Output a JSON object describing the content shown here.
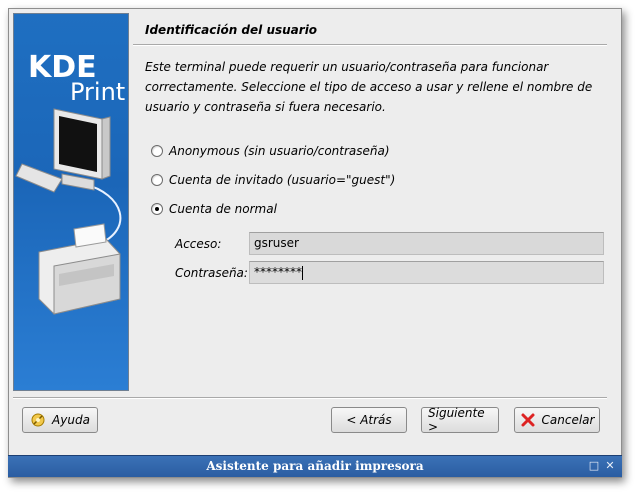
{
  "sidebar": {
    "logo_line1": "KDE",
    "logo_line2": "Print"
  },
  "page": {
    "title": "Identificación del usuario",
    "description": "Este terminal puede requerir un usuario/contraseña para funcionar correctamente. Seleccione el tipo de acceso a usar y rellene el nombre de usuario y contraseña si fuera necesario."
  },
  "options": [
    {
      "label": "Anonymous (sin usuario/contraseña)",
      "selected": false
    },
    {
      "label": "Cuenta de invitado (usuario=\"guest\")",
      "selected": false
    },
    {
      "label": "Cuenta de normal",
      "selected": true
    }
  ],
  "fields": {
    "login_label": "Acceso:",
    "login_value": "gsruser",
    "password_label": "Contraseña:",
    "password_value": "********"
  },
  "buttons": {
    "help": "Ayuda",
    "back": "< Atrás",
    "next": "Siguiente >",
    "cancel": "Cancelar"
  },
  "window": {
    "title": "Asistente para añadir impresora"
  },
  "colors": {
    "titlebar": "#2f64aa",
    "sidebar": "#1f6fc1",
    "dialog_bg": "#ededed"
  }
}
